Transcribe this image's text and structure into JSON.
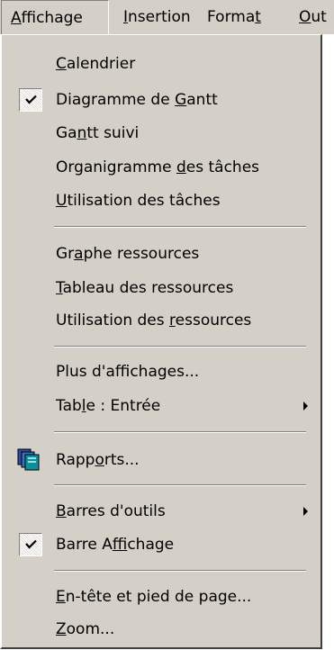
{
  "menubar": {
    "items": [
      {
        "pre": "",
        "ul": "A",
        "post": "ffichage"
      },
      {
        "pre": "",
        "ul": "I",
        "post": "nsertion"
      },
      {
        "pre": "Forma",
        "ul": "t",
        "post": ""
      },
      {
        "pre": "",
        "ul": "O",
        "post": "ut"
      }
    ]
  },
  "menu": {
    "calendrier": {
      "pre": "",
      "ul": "C",
      "post": "alendrier"
    },
    "gantt": {
      "pre": "Diagramme de ",
      "ul": "G",
      "post": "antt"
    },
    "gantt_suivi": {
      "pre": "Ga",
      "ul": "n",
      "post": "tt suivi"
    },
    "organigramme": {
      "pre": "Organigramme ",
      "ul": "d",
      "post": "es tâches"
    },
    "utilisation_taches": {
      "pre": "",
      "ul": "U",
      "post": "tilisation des tâches"
    },
    "graphe_ressources": {
      "pre": "Gr",
      "ul": "a",
      "post": "phe ressources"
    },
    "tableau_ressources": {
      "pre": "",
      "ul": "T",
      "post": "ableau des ressources"
    },
    "utilisation_ressources": {
      "pre": "Utilisation des ",
      "ul": "r",
      "post": "essources"
    },
    "plus_affichages": {
      "pre": "Plus d'aff",
      "ul": "i",
      "post": "chages..."
    },
    "table": {
      "pre": "Tab",
      "ul": "l",
      "post": "e : Entrée"
    },
    "rapports": {
      "pre": "Rapp",
      "ul": "o",
      "post": "rts..."
    },
    "barres_outils": {
      "pre": "",
      "ul": "B",
      "post": "arres d'outils"
    },
    "barre_affichage": {
      "pre": "Barre A",
      "ul": "f",
      "post": "fichage"
    },
    "entete": {
      "pre": "",
      "ul": "E",
      "post": "n-tête et pied de page..."
    },
    "zoom": {
      "pre": "",
      "ul": "Z",
      "post": "oom..."
    }
  },
  "icons": {
    "check": "checkmark-icon",
    "submenu": "submenu-arrow-icon",
    "reports": "reports-icon"
  }
}
